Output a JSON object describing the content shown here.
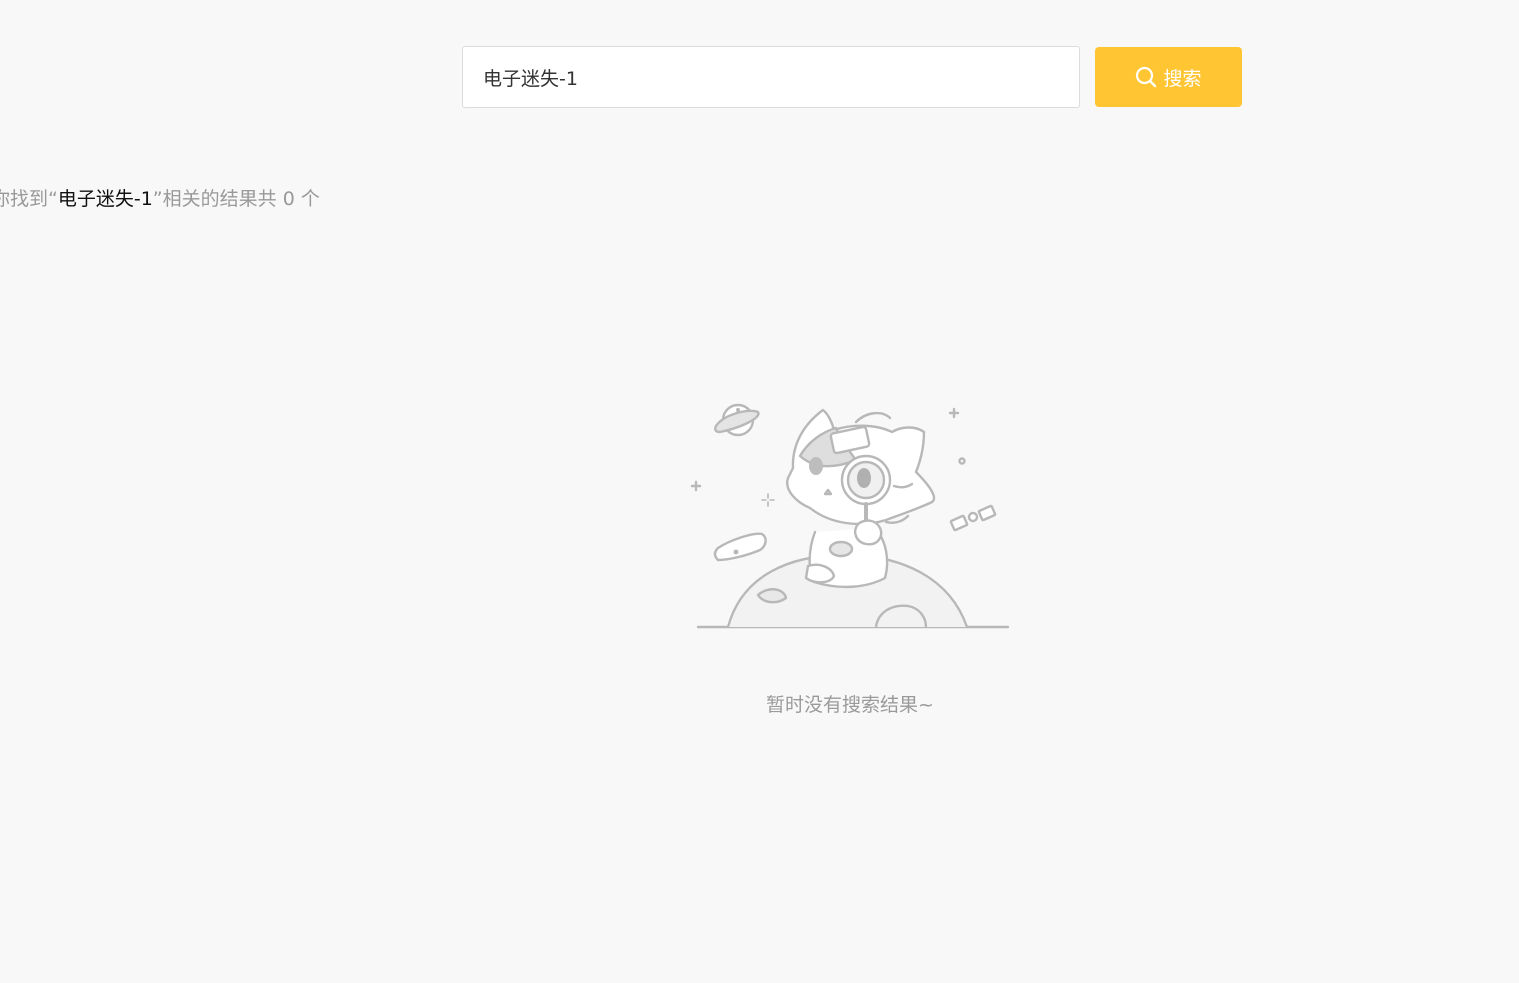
{
  "search": {
    "value": "电子迷失-1",
    "button_label": "搜索",
    "button_icon": "search-icon",
    "accent_color": "#ffc533"
  },
  "summary": {
    "prefix": "为你找到“",
    "keyword": "电子迷失-1",
    "middle": "”相关的结果共 ",
    "count": "0",
    "suffix": " 个"
  },
  "empty_state": {
    "illustration": "cat-with-magnifier-on-planet",
    "message": "暂时没有搜索结果~"
  }
}
